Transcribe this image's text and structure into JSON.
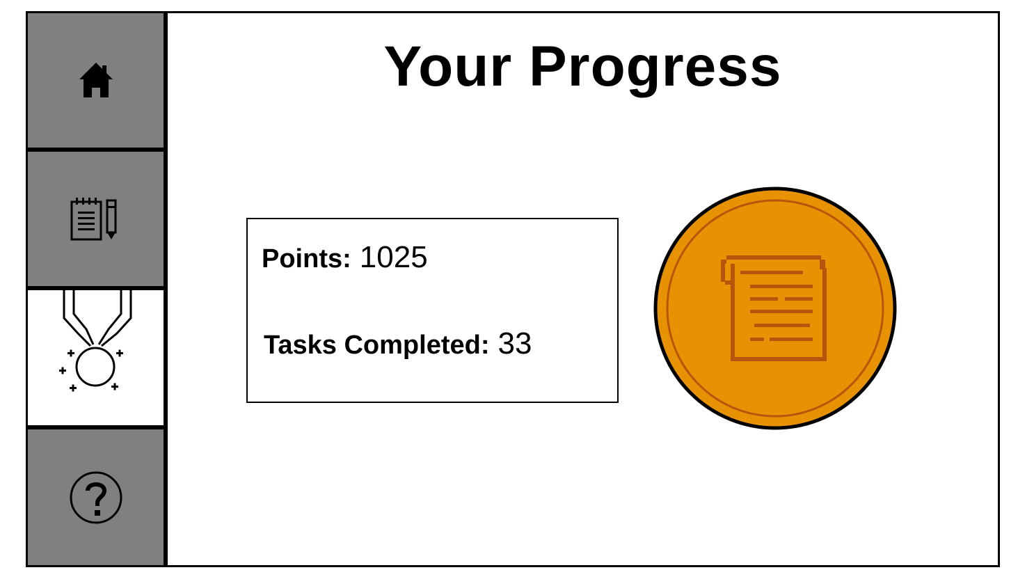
{
  "sidebar": {
    "items": [
      {
        "id": "home",
        "icon": "home-icon",
        "active": false
      },
      {
        "id": "tasks",
        "icon": "notepad-pencil-icon",
        "active": false
      },
      {
        "id": "progress",
        "icon": "medal-icon",
        "active": true
      },
      {
        "id": "help",
        "icon": "question-icon",
        "active": false
      }
    ]
  },
  "main": {
    "title": "Your Progress",
    "stats": {
      "points_label": "Points:",
      "points_value": "1025",
      "tasks_label": "Tasks Completed:",
      "tasks_value": "33"
    },
    "badge": {
      "icon": "scroll-coin-icon",
      "color": "#E69203",
      "detail_color": "#B5560C"
    }
  },
  "colors": {
    "sidebar_bg": "#808080",
    "sidebar_active_bg": "#FFFFFF",
    "border": "#000000"
  }
}
